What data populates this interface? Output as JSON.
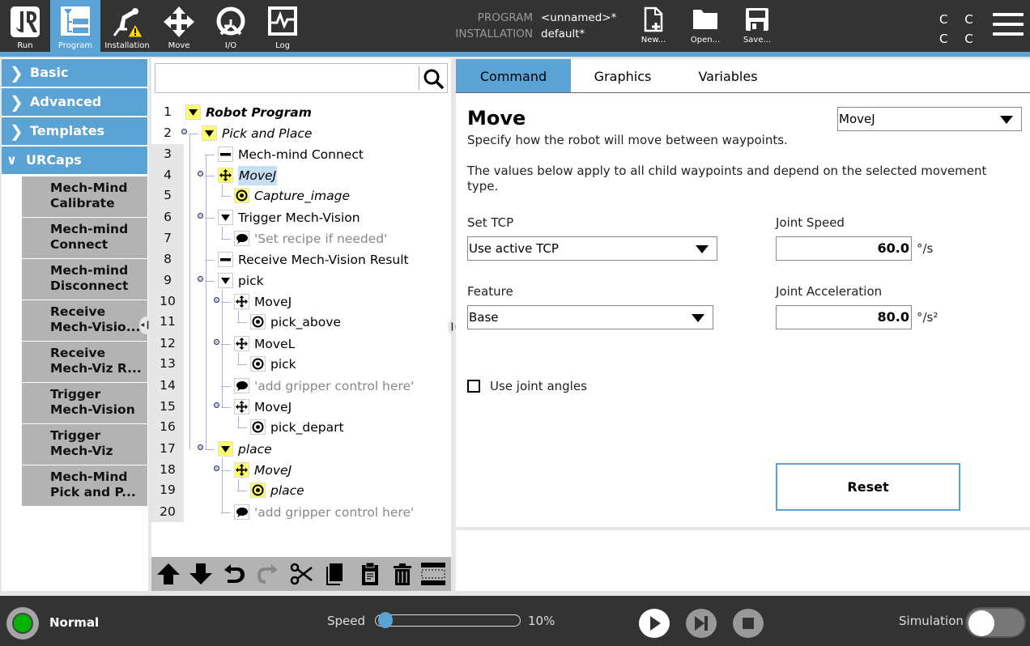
{
  "header": {
    "nav": [
      {
        "label": "Run",
        "icon": "ur-logo-icon",
        "active": false
      },
      {
        "label": "Program",
        "icon": "program-tree-icon",
        "active": true
      },
      {
        "label": "Installation",
        "icon": "robot-arm-warning-icon",
        "active": false
      },
      {
        "label": "Move",
        "icon": "move-arrows-icon",
        "active": false
      },
      {
        "label": "I/O",
        "icon": "io-icon",
        "active": false
      },
      {
        "label": "Log",
        "icon": "log-chart-icon",
        "active": false
      }
    ],
    "program_key": "PROGRAM",
    "program_value": "<unnamed>*",
    "installation_key": "INSTALLATION",
    "installation_value": "default*",
    "file_buttons": [
      {
        "label": "New...",
        "icon": "new-file-icon"
      },
      {
        "label": "Open...",
        "icon": "folder-icon"
      },
      {
        "label": "Save...",
        "icon": "save-disk-icon"
      }
    ],
    "cc_indicator": "C C\nC C",
    "accent": "#5ba3d5"
  },
  "categories": [
    {
      "label": "Basic",
      "expanded": false
    },
    {
      "label": "Advanced",
      "expanded": false
    },
    {
      "label": "Templates",
      "expanded": false
    },
    {
      "label": "URCaps",
      "expanded": true
    }
  ],
  "urcaps": [
    {
      "line1": "Mech-Mind",
      "line2": "Calibrate"
    },
    {
      "line1": "Mech-mind",
      "line2": "Connect"
    },
    {
      "line1": "Mech-mind",
      "line2": "Disconnect"
    },
    {
      "line1": "Receive",
      "line2": "Mech-Visio..."
    },
    {
      "line1": "Receive",
      "line2": "Mech-Viz R..."
    },
    {
      "line1": "Trigger",
      "line2": "Mech-Vision"
    },
    {
      "line1": "Trigger",
      "line2": "Mech-Viz"
    },
    {
      "line1": "Mech-Mind",
      "line2": "Pick and P..."
    }
  ],
  "search": {
    "placeholder": "",
    "value": ""
  },
  "tree": [
    {
      "line": "1",
      "label": "Robot Program",
      "type": "folder",
      "style": "bold-italic",
      "highlight": true
    },
    {
      "line": "2",
      "label": "Pick and Place",
      "type": "folder",
      "style": "italic",
      "highlight": true
    },
    {
      "line": "3",
      "label": "Mech-mind Connect",
      "type": "urcap",
      "style": "normal",
      "highlight": false
    },
    {
      "line": "4",
      "label": "MoveJ",
      "type": "move",
      "style": "italic",
      "highlight": true,
      "selected": true
    },
    {
      "line": "5",
      "label": "Capture_image",
      "type": "waypoint",
      "style": "italic",
      "highlight": true
    },
    {
      "line": "6",
      "label": "Trigger Mech-Vision",
      "type": "folder",
      "style": "normal",
      "highlight": false
    },
    {
      "line": "7",
      "label": "'Set recipe if needed'",
      "type": "comment",
      "style": "comment",
      "highlight": false
    },
    {
      "line": "8",
      "label": "Receive Mech-Vision Result",
      "type": "urcap",
      "style": "normal",
      "highlight": false
    },
    {
      "line": "9",
      "label": "pick",
      "type": "folder",
      "style": "normal",
      "highlight": false
    },
    {
      "line": "10",
      "label": "MoveJ",
      "type": "move",
      "style": "normal",
      "highlight": false
    },
    {
      "line": "11",
      "label": "pick_above",
      "type": "waypoint",
      "style": "normal",
      "highlight": false
    },
    {
      "line": "12",
      "label": "MoveL",
      "type": "move",
      "style": "normal",
      "highlight": false
    },
    {
      "line": "13",
      "label": "pick",
      "type": "waypoint",
      "style": "normal",
      "highlight": false
    },
    {
      "line": "14",
      "label": "'add gripper control here'",
      "type": "comment",
      "style": "comment",
      "highlight": false
    },
    {
      "line": "15",
      "label": "MoveJ",
      "type": "move",
      "style": "normal",
      "highlight": false
    },
    {
      "line": "16",
      "label": "pick_depart",
      "type": "waypoint",
      "style": "normal",
      "highlight": false
    },
    {
      "line": "17",
      "label": "place",
      "type": "folder",
      "style": "italic",
      "highlight": true
    },
    {
      "line": "18",
      "label": "MoveJ",
      "type": "move",
      "style": "italic",
      "highlight": true
    },
    {
      "line": "19",
      "label": "place",
      "type": "waypoint",
      "style": "italic",
      "highlight": true
    },
    {
      "line": "20",
      "label": "'add gripper control here'",
      "type": "comment",
      "style": "comment",
      "highlight": false
    }
  ],
  "tree_toolbar": [
    "move-up-icon",
    "move-down-icon",
    "undo-icon",
    "redo-icon",
    "cut-icon",
    "copy-icon",
    "paste-icon",
    "delete-icon",
    "suppress-icon"
  ],
  "tabs": [
    {
      "label": "Command",
      "active": true
    },
    {
      "label": "Graphics",
      "active": false
    },
    {
      "label": "Variables",
      "active": false
    }
  ],
  "command": {
    "title": "Move",
    "subtitle": "Specify how the robot will move between waypoints.",
    "description": "The values below apply to all child waypoints and depend on the selected movement type.",
    "move_type": "MoveJ",
    "set_tcp_label": "Set TCP",
    "set_tcp_value": "Use active TCP",
    "feature_label": "Feature",
    "feature_value": "Base",
    "joint_speed_label": "Joint Speed",
    "joint_speed_value": "60.0",
    "joint_speed_unit": "°/s",
    "joint_accel_label": "Joint Acceleration",
    "joint_accel_value": "80.0",
    "joint_accel_unit": "°/s²",
    "use_joint_angles_label": "Use joint angles",
    "use_joint_angles_checked": false,
    "reset_label": "Reset"
  },
  "footer": {
    "status": "Normal",
    "status_color": "#00b400",
    "speed_label": "Speed",
    "speed_value": "10%",
    "speed_fraction": 0.1,
    "simulation_label": "Simulation",
    "simulation_on": false
  }
}
